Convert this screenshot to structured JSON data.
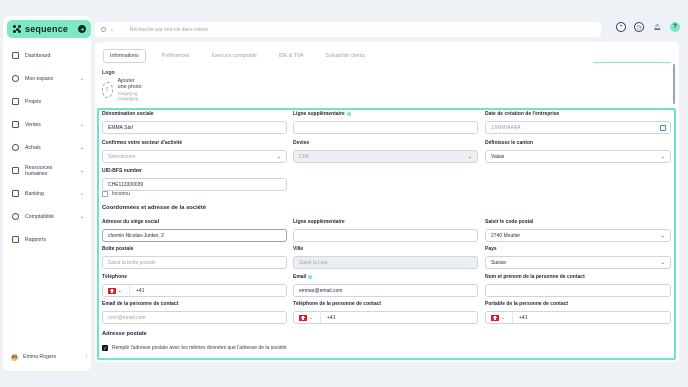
{
  "brand": {
    "name": "sequence",
    "accent": "#7ee8c4"
  },
  "sidebar": {
    "items": [
      {
        "label": "Dashboard",
        "icon": "home-icon",
        "chevron": false
      },
      {
        "label": "Mon espace",
        "icon": "user-icon",
        "chevron": true
      },
      {
        "label": "Projets",
        "icon": "check-square-icon",
        "chevron": false
      },
      {
        "label": "Ventes",
        "icon": "lock-icon",
        "chevron": true
      },
      {
        "label": "Achats",
        "icon": "tag-icon",
        "chevron": true
      },
      {
        "label": "Ressources humaines",
        "icon": "people-icon",
        "chevron": true
      },
      {
        "label": "Banking",
        "icon": "bank-icon",
        "chevron": true
      },
      {
        "label": "Comptabilité",
        "icon": "document-icon",
        "chevron": true
      },
      {
        "label": "Rapports",
        "icon": "chart-icon",
        "chevron": false
      }
    ],
    "user": {
      "name": "Emma Rogers",
      "initials": "ER"
    }
  },
  "search": {
    "placeholder": "Recherche par mot-clé dans clients",
    "scope": "Q"
  },
  "tabs": [
    {
      "label": "Informations",
      "active": true
    },
    {
      "label": "Préférences",
      "active": false
    },
    {
      "label": "Exercice comptable",
      "active": false
    },
    {
      "label": "IDE & TVA",
      "active": false
    },
    {
      "label": "Solvabilité clients",
      "active": false
    }
  ],
  "logo": {
    "label": "Logo",
    "add_text": "Ajouter une photo",
    "formats": "image/png, image/jpeg"
  },
  "form": {
    "denomination": {
      "label": "Dénomination sociale",
      "value": "EMMA Sàrl"
    },
    "ligne_sup": {
      "label": "Ligne supplémentaire",
      "value": ""
    },
    "date_creation": {
      "label": "Date de création de l'entreprise",
      "placeholder": "JJ/MM/AAAA"
    },
    "secteur": {
      "label": "Confirmez votre secteur d'activité",
      "placeholder": "Sélectionner"
    },
    "devise": {
      "label": "Devise",
      "value": "CHF"
    },
    "canton": {
      "label": "Définissez le canton",
      "value": "Valais"
    },
    "uid": {
      "label": "UID-BFS number",
      "value": "CHE113330039"
    },
    "inconnu": {
      "label": "Inconnu",
      "checked": false
    },
    "coord_title": "Coordonnées et adresse de la société",
    "adresse": {
      "label": "Adresse du siège social",
      "value": "chemin Nicolas-Junker, 2"
    },
    "ligne_sup2": {
      "label": "Ligne supplémentaire",
      "value": ""
    },
    "code_postal": {
      "label": "Saisir le code postal",
      "value": "2740 Moutier"
    },
    "boite_postale": {
      "label": "Boîte postale",
      "placeholder": "Saisir la boîte postale"
    },
    "ville": {
      "label": "Ville",
      "placeholder": "Saisir la Lieu"
    },
    "pays": {
      "label": "Pays",
      "value": "Suisse"
    },
    "telephone": {
      "label": "Téléphone",
      "prefix": "+41"
    },
    "email": {
      "label": "Email",
      "value": "emmar@email.com"
    },
    "contact_nom": {
      "label": "Nom et prénom de la personne de contact",
      "value": ""
    },
    "contact_email": {
      "label": "Email de la personne de contact",
      "placeholder": "nom@email.com"
    },
    "contact_tel": {
      "label": "Téléphone de la personne de contact",
      "prefix": "+41"
    },
    "contact_portable": {
      "label": "Portable de la personne de contact",
      "prefix": "+41"
    },
    "postal_title": "Adresse postale",
    "same_address": {
      "label": "Remplir l'adresse postale avec les mêmes données que l'adresse de la société",
      "checked": true
    }
  }
}
